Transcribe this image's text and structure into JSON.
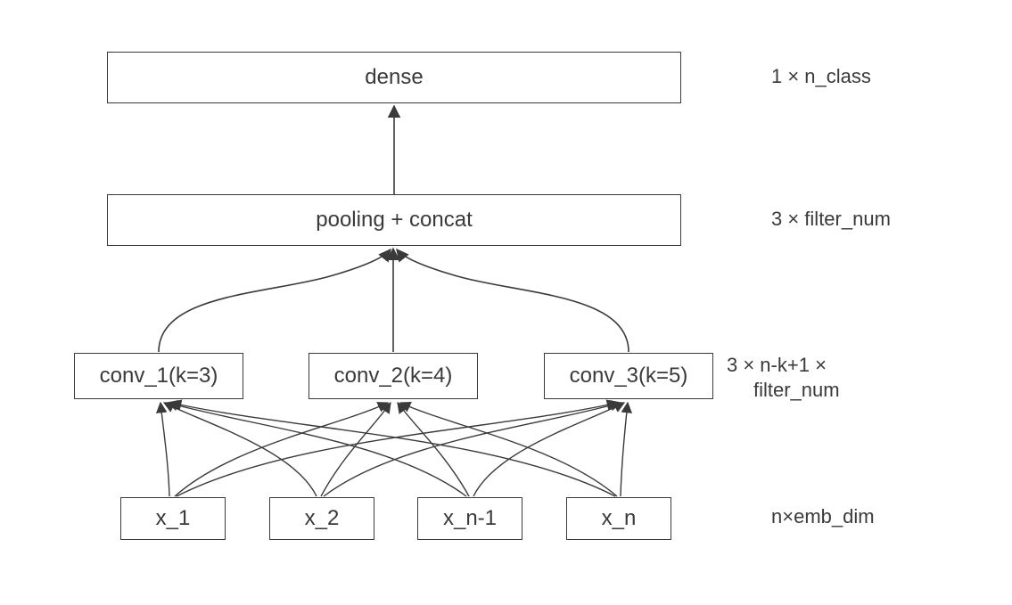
{
  "layers": {
    "dense": {
      "label": "dense"
    },
    "pooling": {
      "label": "pooling + concat"
    },
    "conv1": {
      "label": "conv_1(k=3)"
    },
    "conv2": {
      "label": "conv_2(k=4)"
    },
    "conv3": {
      "label": "conv_3(k=5)"
    },
    "x1": {
      "label": "x_1"
    },
    "x2": {
      "label": "x_2"
    },
    "x3": {
      "label": "x_n-1"
    },
    "x4": {
      "label": "x_n"
    }
  },
  "annotations": {
    "dense_dim": "1 × n_class",
    "pooling_dim": "3 × filter_num",
    "conv_dim_l1": "3 × n-k+1 ×",
    "conv_dim_l2": "filter_num",
    "input_dim": "n×emb_dim"
  }
}
